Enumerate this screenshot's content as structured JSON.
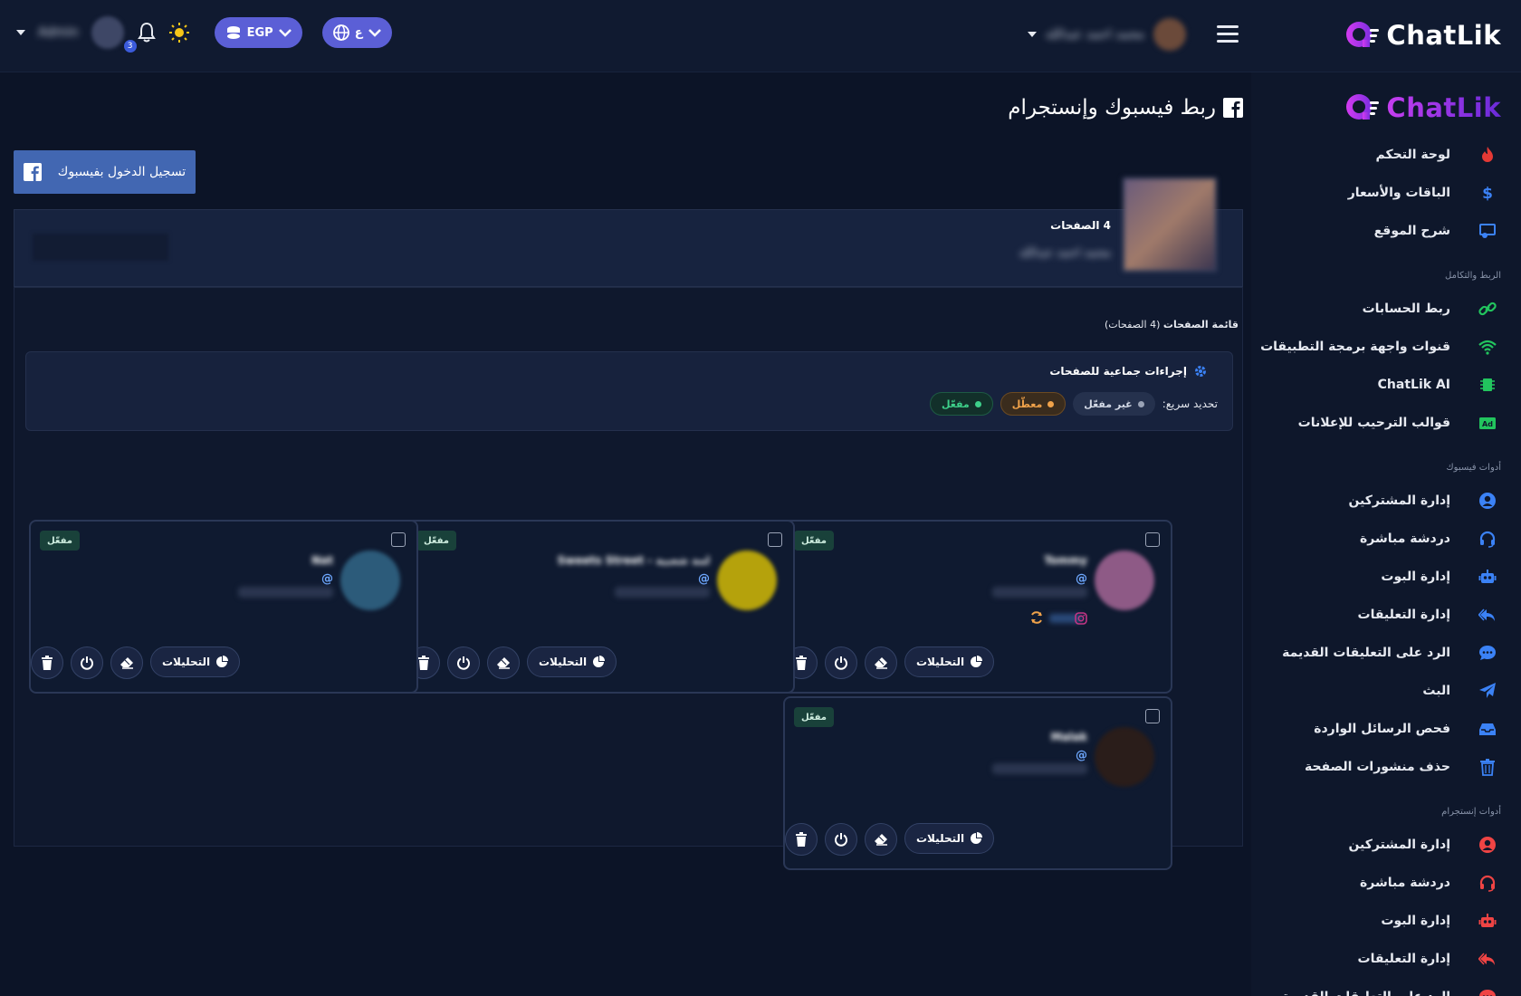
{
  "brand": {
    "name_prefix": "Chat",
    "name_suffix": "Lik"
  },
  "topbar": {
    "currency": "EGP",
    "language": "ع",
    "notifications_count": "3",
    "user_name_blurred": "محمد احمد عبدالله",
    "left_user_blurred": "Admin"
  },
  "sidebar": {
    "main_items": [
      {
        "label": "لوحة التحكم",
        "icon": "fire-icon",
        "color": "#e53935"
      },
      {
        "label": "الباقات والأسعار",
        "icon": "dollar-icon",
        "color": "#3b82f6"
      },
      {
        "label": "شرح الموقع",
        "icon": "video-tutorial-icon",
        "color": "#3b82f6"
      }
    ],
    "section_integration": "الربط والتكامل",
    "integration_items": [
      {
        "label": "ربط الحسابات",
        "icon": "link-icon",
        "color": "#22c55e"
      },
      {
        "label": "قنوات واجهة برمجة التطبيقات",
        "icon": "wifi-icon",
        "color": "#22c55e"
      },
      {
        "label": "ChatLik AI",
        "icon": "chip-icon",
        "color": "#22c55e"
      },
      {
        "label": "قوالب الترحيب للإعلانات",
        "icon": "ad-icon",
        "color": "#22c55e"
      }
    ],
    "section_facebook": "أدوات فيسبوك",
    "facebook_items": [
      {
        "label": "إدارة المشتركين",
        "icon": "user-circle-icon",
        "color": "#3b82f6"
      },
      {
        "label": "دردشة مباشرة",
        "icon": "headset-icon",
        "color": "#3b82f6"
      },
      {
        "label": "إدارة البوت",
        "icon": "robot-icon",
        "color": "#3b82f6"
      },
      {
        "label": "إدارة التعليقات",
        "icon": "reply-all-icon",
        "color": "#3b82f6"
      },
      {
        "label": "الرد على التعليقات القديمة",
        "icon": "comment-dots-icon",
        "color": "#3b82f6"
      },
      {
        "label": "البث",
        "icon": "paper-plane-icon",
        "color": "#3b82f6"
      },
      {
        "label": "فحص الرسائل الواردة",
        "icon": "inbox-icon",
        "color": "#3b82f6"
      },
      {
        "label": "حذف منشورات الصفحة",
        "icon": "trash-icon",
        "color": "#3b82f6"
      }
    ],
    "section_instagram": "أدوات إنستجرام",
    "instagram_items": [
      {
        "label": "إدارة المشتركين",
        "icon": "user-circle-icon",
        "color": "#ef4444"
      },
      {
        "label": "دردشة مباشرة",
        "icon": "headset-icon",
        "color": "#ef4444"
      },
      {
        "label": "إدارة البوت",
        "icon": "robot-icon",
        "color": "#ef4444"
      },
      {
        "label": "إدارة التعليقات",
        "icon": "reply-all-icon",
        "color": "#ef4444"
      },
      {
        "label": "الرد على التعليقات القديمة",
        "icon": "comment-dots-icon",
        "color": "#ef4444"
      }
    ]
  },
  "main": {
    "title": "ربط فيسبوك وإنستجرام",
    "fb_login_label": "تسجيل الدخول بفيسبوك",
    "summary": {
      "count_label": "4 الصفحات",
      "account_name_blurred": "محمد احمد عبدالله"
    },
    "list_title_bold": "قائمة الصفحات",
    "list_title_rest": "(4 الصفحات)",
    "bulk": {
      "title": "إجراءات جماعية للصفحات",
      "quick_select_label": "تحديد سريع:",
      "chip_disabled": "غير مفعّل",
      "chip_paused": "معطّل",
      "chip_enabled": "مفعّل"
    },
    "card_common": {
      "status": "مفعّل",
      "analytics_label": "التحليلات",
      "at_sign": "@"
    },
    "cards": [
      {
        "name_blurred": "Tommy",
        "avatar_color": "#8e5a86",
        "has_instagram": true
      },
      {
        "name_blurred": "لمة شعبية - Sweets Street",
        "avatar_color": "#b5a20c",
        "has_instagram": false
      },
      {
        "name_blurred": "Nat",
        "avatar_color": "#2c5b7a",
        "has_instagram": false
      },
      {
        "name_blurred": "Malak",
        "avatar_color": "#2a1d1a",
        "has_instagram": false
      }
    ]
  }
}
